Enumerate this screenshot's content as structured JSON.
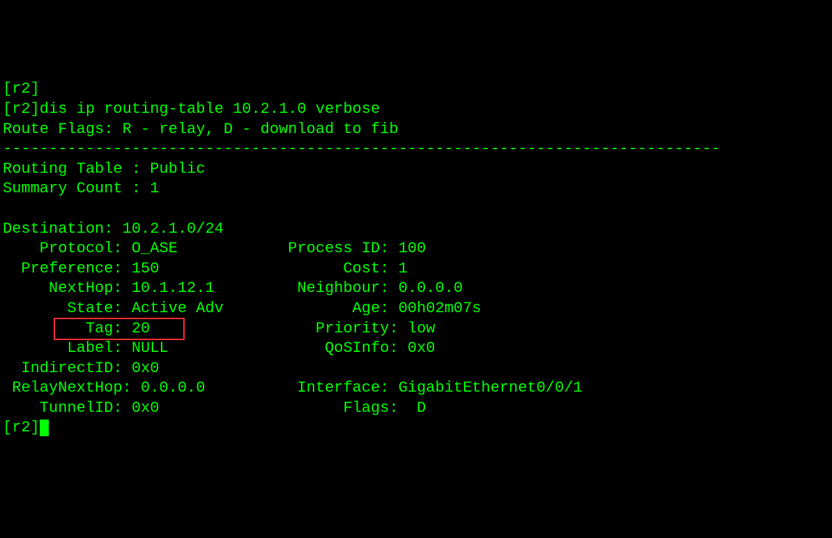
{
  "line0": "[r2]",
  "prompt_line": "[r2]dis ip routing-table 10.2.1.0 verbose",
  "flags_line": "Route Flags: R - relay, D - download to fib",
  "separator": "------------------------------------------------------------------------------",
  "table_line": "Routing Table : Public",
  "summary_line": "Summary Count : 1",
  "destination_line": "Destination: 10.2.1.0/24",
  "rows": [
    {
      "left_label": "    Protocol",
      "left_val": "O_ASE",
      "right_label": "Process ID",
      "right_val": "100"
    },
    {
      "left_label": "  Preference",
      "left_val": "150",
      "right_label": "      Cost",
      "right_val": "1"
    },
    {
      "left_label": "     NextHop",
      "left_val": "10.1.12.1",
      "right_label": " Neighbour",
      "right_val": "0.0.0.0"
    },
    {
      "left_label": "       State",
      "left_val": "Active Adv",
      "right_label": "       Age",
      "right_val": "00h02m07s"
    },
    {
      "left_label": "         Tag",
      "left_val": "20",
      "right_label": "  Priority",
      "right_val": "low"
    },
    {
      "left_label": "       Label",
      "left_val": "NULL",
      "right_label": "   QoSInfo",
      "right_val": "0x0"
    },
    {
      "left_label": "  IndirectID",
      "left_val": "0x0",
      "right_label": "",
      "right_val": ""
    },
    {
      "left_label": " RelayNextHop",
      "left_val": "0.0.0.0",
      "right_label": " Interface",
      "right_val": "GigabitEthernet0/0/1"
    },
    {
      "left_label": "    TunnelID",
      "left_val": "0x0",
      "right_label": "     Flags",
      "right_val": " D"
    }
  ],
  "prompt_end": "[r2]"
}
